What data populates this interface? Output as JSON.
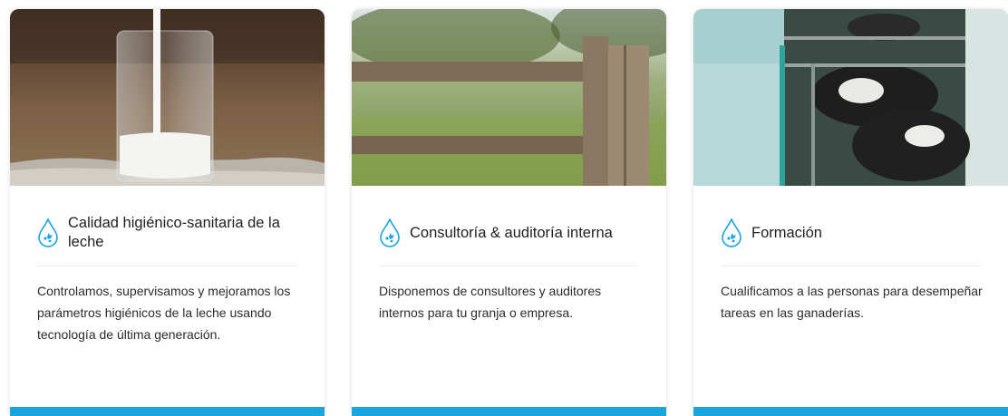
{
  "colors": {
    "accent": "#1aa5de",
    "title_text": "#1f1f1f",
    "body_text": "#2b2b2b"
  },
  "cards": [
    {
      "image": "milk-glass-photo",
      "icon": "water-drop-icon",
      "title": "Calidad higiénico-sanitaria de la leche",
      "description": "Controlamos, supervisamos y mejoramos los parámetros higiénicos de la leche usando tecnología de última generación."
    },
    {
      "image": "wooden-fence-photo",
      "icon": "water-drop-icon",
      "title": "Consultoría & auditoría interna",
      "description": "Disponemos de consultores y auditores internos para tu granja o empresa."
    },
    {
      "image": "cows-milking-parlor-photo",
      "icon": "water-drop-icon",
      "title": "Formación",
      "description": "Cualificamos a las personas para desempeñar tareas en las ganaderías."
    }
  ]
}
